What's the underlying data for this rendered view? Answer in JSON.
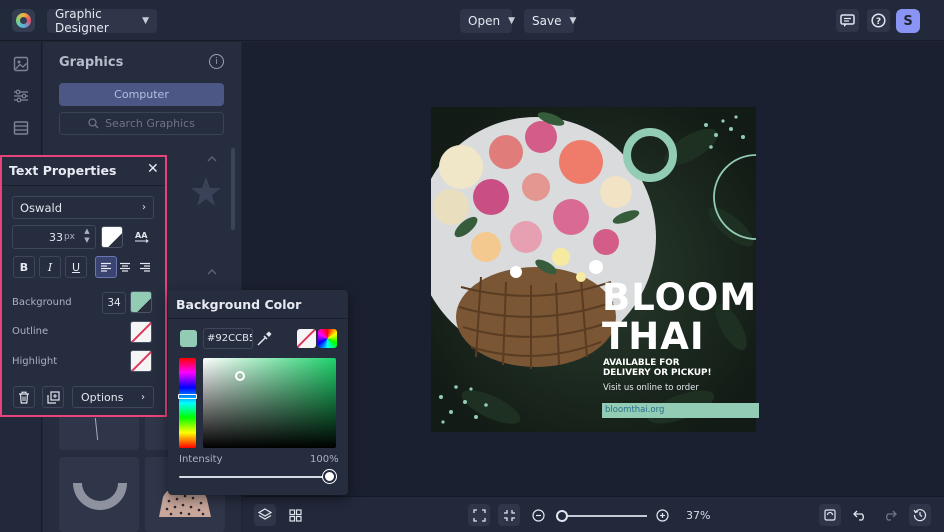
{
  "topbar": {
    "project_label": "Graphic Designer",
    "open_label": "Open",
    "save_label": "Save",
    "avatar_initial": "S"
  },
  "graphics_panel": {
    "title": "Graphics",
    "computer_label": "Computer",
    "search_placeholder": "Search Graphics"
  },
  "text_properties": {
    "title": "Text Properties",
    "font": "Oswald",
    "size": "33",
    "size_unit": "px",
    "background_label": "Background",
    "background_value": "34",
    "outline_label": "Outline",
    "highlight_label": "Highlight",
    "options_label": "Options"
  },
  "background_color": {
    "title": "Background Color",
    "hex": "#92CCB5",
    "intensity_label": "Intensity",
    "intensity_value": "100%",
    "swatch_color": "#92ccb5"
  },
  "poster": {
    "headline_1": "BLOOM",
    "headline_2": "THAI",
    "sub_1": "AVAILABLE FOR",
    "sub_2": "DELIVERY OR PICKUP!",
    "tagline": "Visit us online to order",
    "url": "bloomthai.org"
  },
  "bottombar": {
    "zoom": "37%"
  },
  "colors": {
    "accent_pink": "#e8437a",
    "mint": "#92ccb5",
    "avatar": "#8a94f4"
  }
}
